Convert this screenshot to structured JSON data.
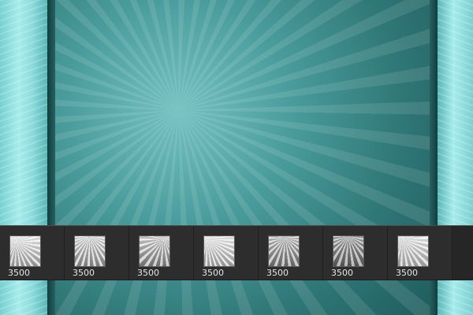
{
  "thumbnails": [
    {
      "label": "3500"
    },
    {
      "label": "3500"
    },
    {
      "label": "3500"
    },
    {
      "label": "3500"
    },
    {
      "label": "3500"
    },
    {
      "label": "3500"
    },
    {
      "label": "3500"
    }
  ],
  "colors": {
    "teal_bg": "#3f8e8e",
    "strip_bg": "#2d2d2d",
    "thumb_label": "#e7e7e7"
  }
}
